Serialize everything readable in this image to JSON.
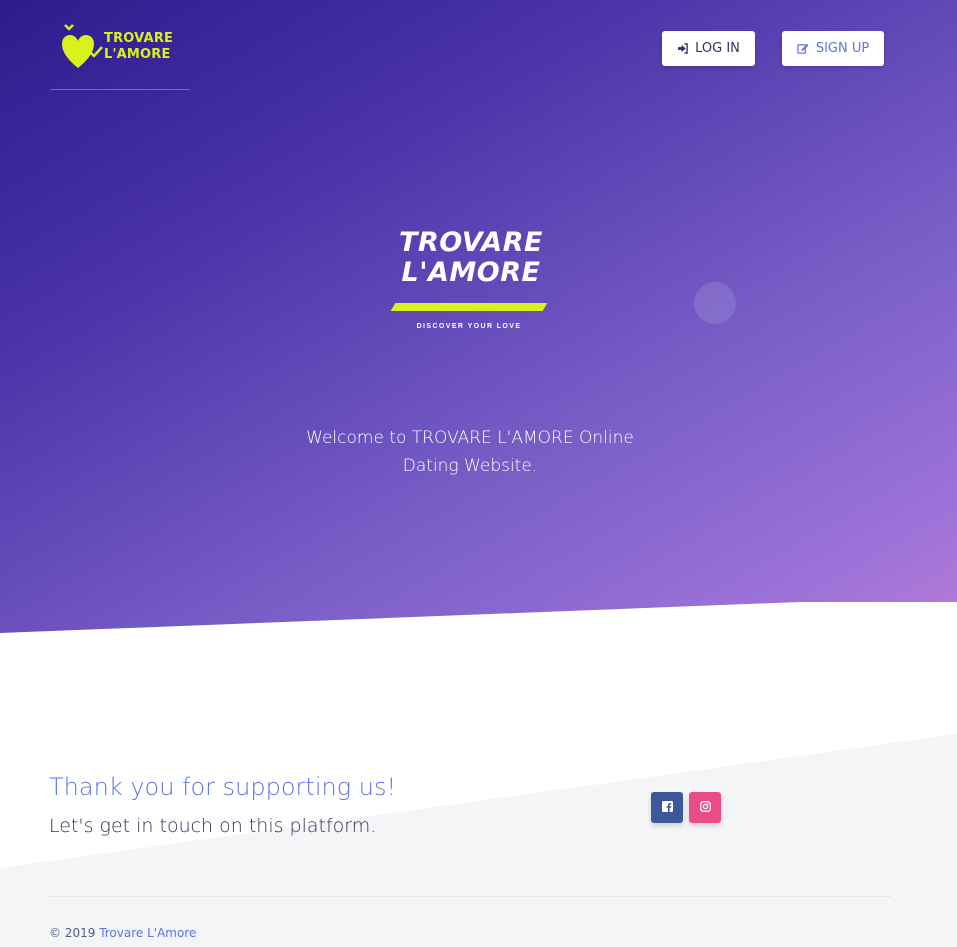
{
  "header": {
    "logo_line1": "TROVARE",
    "logo_line2": "L'AMORE",
    "login_label": "LOG IN",
    "signup_label": "SIGN UP",
    "login_icon": "sign-in-icon",
    "signup_icon": "edit-icon"
  },
  "hero": {
    "logo_line1": "TROVARE",
    "logo_line2": "L'AMORE",
    "tagline": "DISCOVER YOUR LOVE",
    "welcome": "Welcome to TROVARE L'AMORE Online Dating Website."
  },
  "footer": {
    "thanks": "Thank you for supporting us!",
    "touch": "Let's get in touch on this platform.",
    "social": [
      {
        "name": "facebook-square-icon",
        "color": "#3b5998"
      },
      {
        "name": "instagram-icon",
        "color": "#ea4c89"
      }
    ],
    "copyright_prefix": "© 2019",
    "copyright_link": "Trovare L'Amore"
  },
  "colors": {
    "accent": "#5e72e4",
    "brand_lime": "#d8f21a",
    "hero_gradient_start": "#2d1b8c",
    "hero_gradient_end": "#b87ad8",
    "footer_bg": "#f4f5f7"
  }
}
